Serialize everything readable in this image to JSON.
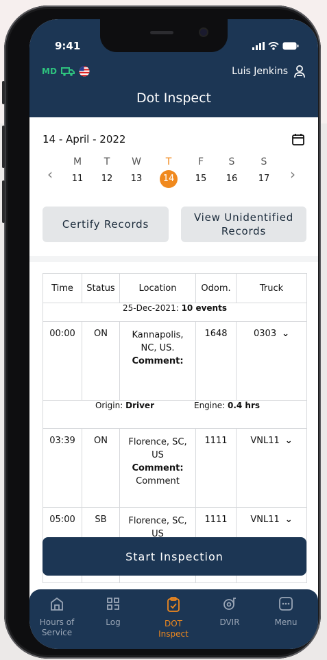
{
  "status_bar": {
    "time": "9:41"
  },
  "header": {
    "md_label": "MD",
    "user_name": "Luis Jenkins",
    "title": "Dot Inspect"
  },
  "date": {
    "label": "14 - April - 2022"
  },
  "week": {
    "days": [
      {
        "letter": "M",
        "num": "11"
      },
      {
        "letter": "T",
        "num": "12"
      },
      {
        "letter": "W",
        "num": "13"
      },
      {
        "letter": "T",
        "num": "14",
        "selected": true
      },
      {
        "letter": "F",
        "num": "15"
      },
      {
        "letter": "S",
        "num": "16"
      },
      {
        "letter": "S",
        "num": "17"
      }
    ],
    "prev": "‹",
    "next": "›"
  },
  "actions": {
    "certify": "Certify Records",
    "view_unidentified_line1": "View Unidentified",
    "view_unidentified_line2": "Records"
  },
  "table": {
    "headers": [
      "Time",
      "Status",
      "Location",
      "Odom.",
      "Truck"
    ],
    "group_label_prefix": "25-Dec-2021: ",
    "group_label_count": "10 events",
    "rows": [
      {
        "time": "00:00",
        "status": "ON",
        "location": "Kannapolis, NC, US.",
        "comment_label": "Comment:",
        "comment": "",
        "odom": "1648",
        "truck": "0303"
      },
      {
        "time": "03:39",
        "status": "ON",
        "location": "Florence, SC, US",
        "comment_label": "Comment:",
        "comment": "Comment",
        "odom": "1111",
        "truck": "VNL11"
      },
      {
        "time": "05:00",
        "status": "SB",
        "location": "Florence, SC, US",
        "comment_label": "",
        "comment": "",
        "odom": "1111",
        "truck": "VNL11"
      }
    ],
    "origin_label": "Origin: ",
    "origin_value": "Driver",
    "engine_label": "Engine: ",
    "engine_value": "0.4 hrs"
  },
  "start_button": "Start Inspection",
  "nav": [
    {
      "label1": "Hours of",
      "label2": "Service",
      "icon": "home-icon"
    },
    {
      "label1": "Log",
      "label2": "",
      "icon": "qr-icon"
    },
    {
      "label1": "DOT",
      "label2": "Inspect",
      "icon": "clipboard-icon",
      "active": true
    },
    {
      "label1": "DVIR",
      "label2": "",
      "icon": "tape-icon"
    },
    {
      "label1": "Menu",
      "label2": "",
      "icon": "menu-icon"
    }
  ],
  "colors": {
    "navy": "#1c3654",
    "accent": "#f0891e",
    "md_green": "#2ec27e"
  }
}
